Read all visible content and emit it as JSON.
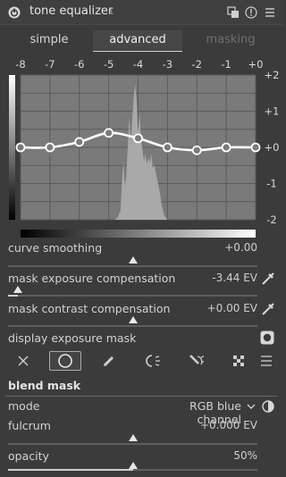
{
  "header": {
    "title": "tone equalizer",
    "instance": "1",
    "icons": [
      "power-icon",
      "presets-icon",
      "reset-icon",
      "menu-icon"
    ]
  },
  "tabs": [
    {
      "label": "simple",
      "active": false
    },
    {
      "label": "advanced",
      "active": true
    },
    {
      "label": "masking",
      "active": false
    }
  ],
  "chart_data": {
    "type": "line",
    "x_tick_labels": [
      "-8",
      "-7",
      "-6",
      "-5",
      "-4",
      "-3",
      "-2",
      "-1",
      "+0"
    ],
    "y_tick_labels": [
      "+2",
      "+1",
      "+0",
      "-1",
      "-2"
    ],
    "xlim": [
      -8,
      0
    ],
    "ylim": [
      -2,
      2
    ],
    "grid": true,
    "curve_points": [
      {
        "x": -8,
        "y": 0.0
      },
      {
        "x": -7,
        "y": 0.0
      },
      {
        "x": -6,
        "y": 0.15
      },
      {
        "x": -5,
        "y": 0.4
      },
      {
        "x": -4,
        "y": 0.25
      },
      {
        "x": -3,
        "y": 0.0
      },
      {
        "x": -2,
        "y": -0.08
      },
      {
        "x": -1,
        "y": 0.0
      },
      {
        "x": 0,
        "y": 0.0
      }
    ],
    "histogram": [
      [
        -4.8,
        0
      ],
      [
        -4.7,
        0.05
      ],
      [
        -4.6,
        0.25
      ],
      [
        -4.55,
        1.0
      ],
      [
        -4.5,
        1.6
      ],
      [
        -4.45,
        0.9
      ],
      [
        -4.4,
        1.2
      ],
      [
        -4.35,
        2.0
      ],
      [
        -4.3,
        2.8
      ],
      [
        -4.25,
        2.1
      ],
      [
        -4.2,
        2.7
      ],
      [
        -4.15,
        3.3
      ],
      [
        -4.1,
        3.7
      ],
      [
        -4.05,
        3.2
      ],
      [
        -4.0,
        2.4
      ],
      [
        -3.95,
        2.9
      ],
      [
        -3.9,
        2.2
      ],
      [
        -3.85,
        1.9
      ],
      [
        -3.8,
        1.6
      ],
      [
        -3.75,
        1.8
      ],
      [
        -3.7,
        1.5
      ],
      [
        -3.65,
        1.7
      ],
      [
        -3.6,
        1.55
      ],
      [
        -3.55,
        1.8
      ],
      [
        -3.5,
        1.4
      ],
      [
        -3.45,
        1.5
      ],
      [
        -3.4,
        1.3
      ],
      [
        -3.35,
        1.1
      ],
      [
        -3.3,
        0.9
      ],
      [
        -3.25,
        0.7
      ],
      [
        -3.2,
        0.4
      ],
      [
        -3.1,
        0.1
      ],
      [
        -3.0,
        0
      ]
    ]
  },
  "sliders": [
    {
      "label": "curve smoothing",
      "value": "+0.00",
      "position": 0.5,
      "picker": false
    },
    {
      "label": "mask exposure compensation",
      "value": "-3.44 EV",
      "position": 0.04,
      "picker": true
    },
    {
      "label": "mask contrast compensation",
      "value": "+0.00 EV",
      "position": 0.5,
      "picker": true
    }
  ],
  "display_mask": {
    "label": "display exposure mask"
  },
  "blend_toolbar": {
    "icons": [
      "off-icon",
      "uniformly-icon",
      "drawn-mask-icon",
      "parametric-mask-icon",
      "drawn-parametric-mask-icon",
      "raster-mask-icon",
      "menu-icon"
    ],
    "selected": 1
  },
  "blend_mask": {
    "title": "blend mask",
    "mode_label": "mode",
    "mode_value": "RGB blue channel",
    "fulcrum_label": "fulcrum",
    "fulcrum_value": "+0.000 EV",
    "fulcrum_position": 0.5,
    "opacity_label": "opacity",
    "opacity_value": "50%",
    "opacity_position": 0.5
  }
}
